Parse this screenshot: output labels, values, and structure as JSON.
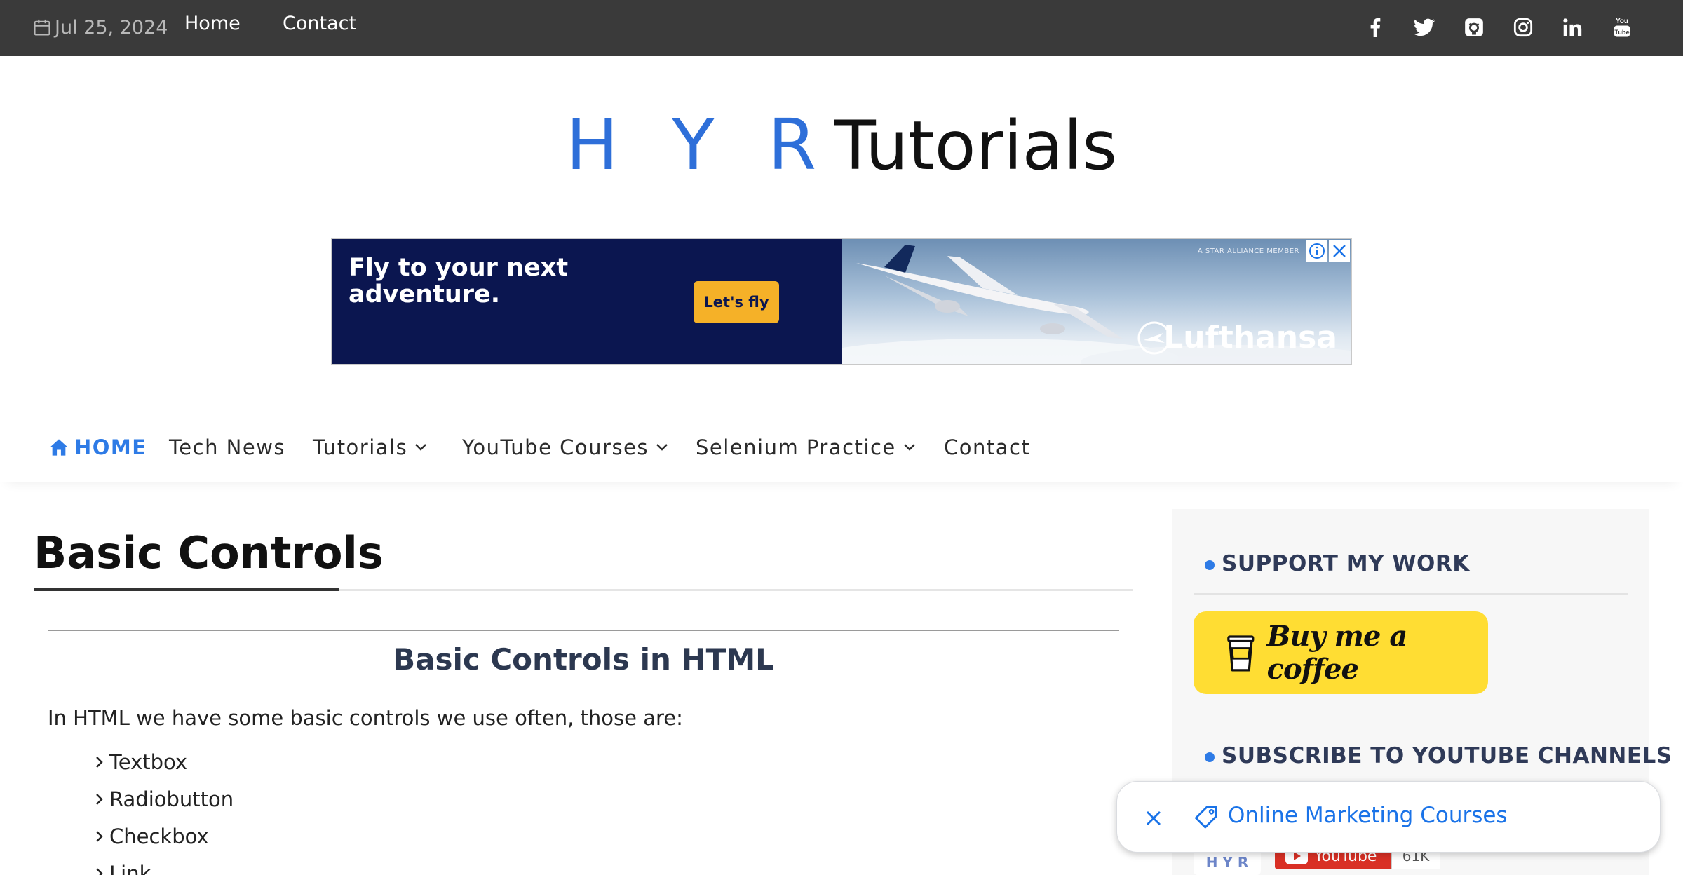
{
  "topbar": {
    "date": "Jul 25, 2024",
    "links": [
      "Home",
      "Contact"
    ],
    "social": [
      "facebook-icon",
      "twitter-icon",
      "github-icon",
      "instagram-icon",
      "linkedin-icon",
      "youtube-icon"
    ]
  },
  "logo": {
    "part1": "H Y R",
    "part2": "Tutorials",
    "color_part1": "#2e6fd9"
  },
  "ad": {
    "headline": "Fly to your next adventure.",
    "cta": "Let's fly",
    "member": "A STAR ALLIANCE MEMBER",
    "brand": "Lufthansa"
  },
  "nav": {
    "items": [
      {
        "label": "HOME",
        "icon": "home-icon"
      },
      {
        "label": "Tech News"
      },
      {
        "label": "Tutorials",
        "dropdown": true
      },
      {
        "label": "YouTube Courses",
        "dropdown": true
      },
      {
        "label": "Selenium Practice",
        "dropdown": true
      },
      {
        "label": "Contact"
      }
    ]
  },
  "article": {
    "title": "Basic Controls",
    "subheading": "Basic Controls in HTML",
    "intro": "In HTML we have some basic controls we use often, those are:",
    "list": [
      "Textbox",
      "Radiobutton",
      "Checkbox",
      "Link"
    ]
  },
  "sidebar": {
    "support_title": "SUPPORT MY WORK",
    "coffee_label": "Buy me a coffee",
    "subscribe_title": "SUBSCRIBE TO YOUTUBE CHANNELS",
    "youtube_label": "YouTube",
    "youtube_count": "61K",
    "channel_thumb": "H Y R"
  },
  "chip": {
    "label": "Online Marketing Courses"
  },
  "colors": {
    "accent": "#2e7be6",
    "topbar": "#3a3a3a",
    "coffee": "#ffdd33",
    "chip_text": "#1a73e8"
  }
}
